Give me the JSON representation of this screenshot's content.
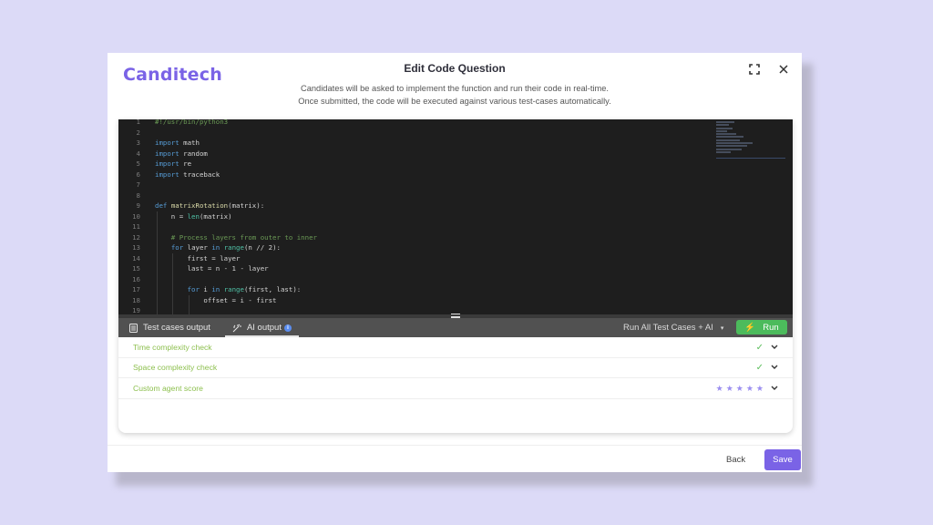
{
  "brand": {
    "name": "Canditech",
    "color": "#7a63e6"
  },
  "header": {
    "title": "Edit Code Question",
    "subtitle_line1": "Candidates will be asked to implement the function and run their code in real-time.",
    "subtitle_line2": "Once submitted, the code will be executed against various test-cases automatically.",
    "expand_icon": "fullscreen-icon",
    "close_icon": "close-icon"
  },
  "editor": {
    "language": "python",
    "lines": [
      {
        "n": "1",
        "text": "#!/usr/bin/python3"
      },
      {
        "n": "2",
        "text": ""
      },
      {
        "n": "3",
        "text": "import math"
      },
      {
        "n": "4",
        "text": "import random"
      },
      {
        "n": "5",
        "text": "import re"
      },
      {
        "n": "6",
        "text": "import traceback"
      },
      {
        "n": "7",
        "text": ""
      },
      {
        "n": "8",
        "text": ""
      },
      {
        "n": "9",
        "text": "def matrixRotation(matrix):"
      },
      {
        "n": "10",
        "text": "    n = len(matrix)"
      },
      {
        "n": "11",
        "text": ""
      },
      {
        "n": "12",
        "text": "    # Process layers from outer to inner"
      },
      {
        "n": "13",
        "text": "    for layer in range(n // 2):"
      },
      {
        "n": "14",
        "text": "        first = layer"
      },
      {
        "n": "15",
        "text": "        last = n - 1 - layer"
      },
      {
        "n": "16",
        "text": ""
      },
      {
        "n": "17",
        "text": "        for i in range(first, last):"
      },
      {
        "n": "18",
        "text": "            offset = i - first"
      },
      {
        "n": "19",
        "text": ""
      }
    ]
  },
  "tabs": [
    {
      "label": "Test cases output",
      "icon": "document-icon",
      "active": false
    },
    {
      "label": "AI output",
      "icon": "magic-wand-icon",
      "active": true,
      "info": "i"
    }
  ],
  "run_all": {
    "label": "Run All Test Cases + AI",
    "caret": "▾"
  },
  "run_button": {
    "label": "Run",
    "icon": "⚡"
  },
  "results": [
    {
      "label": "Time complexity check",
      "status": "pass",
      "check": "✓",
      "chevron": "⌄"
    },
    {
      "label": "Space complexity check",
      "status": "pass",
      "check": "✓",
      "chevron": "⌄"
    },
    {
      "label": "Custom agent score",
      "status": "score",
      "score": 5,
      "max_score": 5,
      "star": "★",
      "chevron": "⌄"
    }
  ],
  "footer": {
    "back_label": "Back",
    "save_label": "Save"
  },
  "colors": {
    "accent": "#7a63e6",
    "run_green": "#4cbb5c",
    "pass_text": "#8cbf4d",
    "editor_bg": "#1e1e1e",
    "tabbar_bg": "#515151"
  }
}
